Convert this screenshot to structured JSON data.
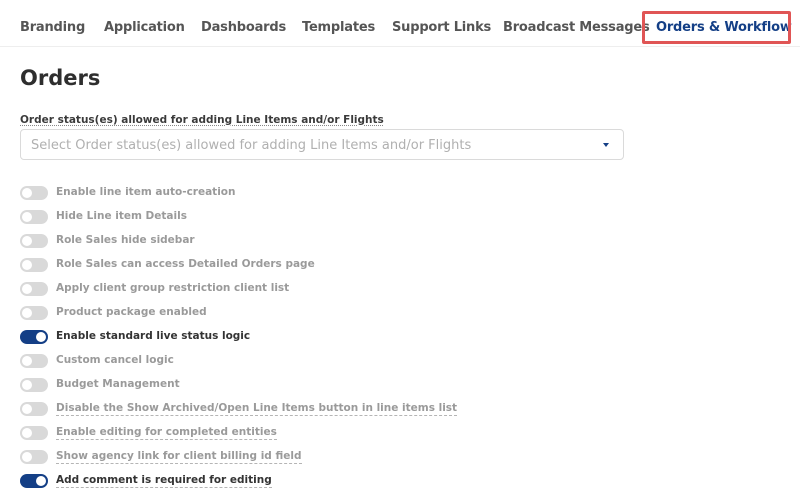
{
  "tabs": [
    {
      "label": "Branding",
      "active": false
    },
    {
      "label": "Application",
      "active": false
    },
    {
      "label": "Dashboards",
      "active": false
    },
    {
      "label": "Templates",
      "active": false
    },
    {
      "label": "Support Links",
      "active": false
    },
    {
      "label": "Broadcast Messages",
      "active": false
    },
    {
      "label": "Orders & Workflow",
      "active": true
    }
  ],
  "page": {
    "title": "Orders"
  },
  "order_status_field": {
    "label": "Order status(es) allowed for adding Line Items and/or Flights",
    "placeholder": "Select Order status(es) allowed for adding Line Items and/or Flights",
    "caret_icon": "caret-down-icon"
  },
  "toggles": [
    {
      "label": "Enable line item auto-creation",
      "enabled": false
    },
    {
      "label": "Hide Line item Details",
      "enabled": false
    },
    {
      "label": "Role Sales hide sidebar",
      "enabled": false
    },
    {
      "label": "Role Sales can access Detailed Orders page",
      "enabled": false
    },
    {
      "label": "Apply client group restriction client list",
      "enabled": false
    },
    {
      "label": "Product package enabled",
      "enabled": false
    },
    {
      "label": "Enable standard live status logic",
      "enabled": true
    },
    {
      "label": "Custom cancel logic",
      "enabled": false
    },
    {
      "label": "Budget Management",
      "enabled": false
    },
    {
      "label": "Disable the Show Archived/Open Line Items button in line items list",
      "enabled": false
    },
    {
      "label": "Enable editing for completed entities",
      "enabled": false
    },
    {
      "label": "Show agency link for client billing id field",
      "enabled": false
    },
    {
      "label": "Add comment is required for editing",
      "enabled": true
    }
  ],
  "colors": {
    "accent": "#143f86",
    "highlight": "#e05555",
    "toggle_off": "#d9d9d9"
  }
}
